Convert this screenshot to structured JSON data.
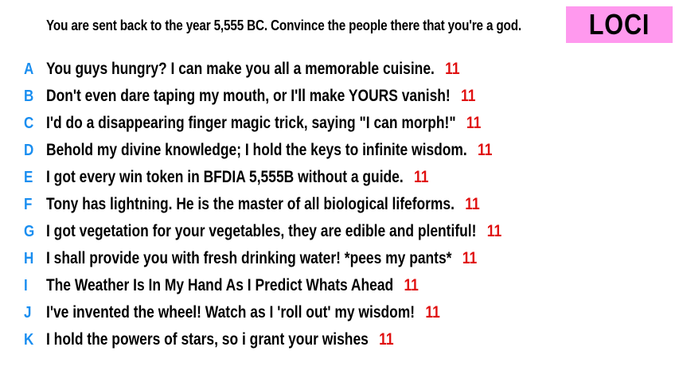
{
  "prompt": "You are sent back to the year 5,555 BC. Convince the people there that you're a god.",
  "badge": {
    "label": "LOCI",
    "color": "#ff99ee"
  },
  "colors": {
    "letter": "#1a8ef0",
    "score": "#e01010"
  },
  "answers": [
    {
      "letter": "A",
      "text": "You guys hungry? I can make you all a memorable cuisine.",
      "score": "11"
    },
    {
      "letter": "B",
      "text": "Don't even dare taping my mouth, or I'll make YOURS vanish!",
      "score": "11"
    },
    {
      "letter": "C",
      "text": "I'd do a disappearing finger magic trick, saying \"I can morph!\"",
      "score": "11"
    },
    {
      "letter": "D",
      "text": "Behold my divine knowledge; I hold the keys to infinite wisdom.",
      "score": "11"
    },
    {
      "letter": "E",
      "text": "I got every win token in BFDIA 5,555B without a guide.",
      "score": "11"
    },
    {
      "letter": "F",
      "text": "Tony has lightning. He is the master of all biological lifeforms.",
      "score": "11"
    },
    {
      "letter": "G",
      "text": "I got vegetation for your vegetables, they are edible and plentiful!",
      "score": "11"
    },
    {
      "letter": "H",
      "text": "I shall provide you with fresh drinking water! *pees my pants*",
      "score": "11"
    },
    {
      "letter": "I",
      "text": "The Weather Is In My Hand As I Predict Whats Ahead",
      "score": "11"
    },
    {
      "letter": "J",
      "text": "I've invented the wheel! Watch as I 'roll out' my wisdom!",
      "score": "11"
    },
    {
      "letter": "K",
      "text": "I hold the powers of stars, so i grant your wishes",
      "score": "11"
    }
  ]
}
